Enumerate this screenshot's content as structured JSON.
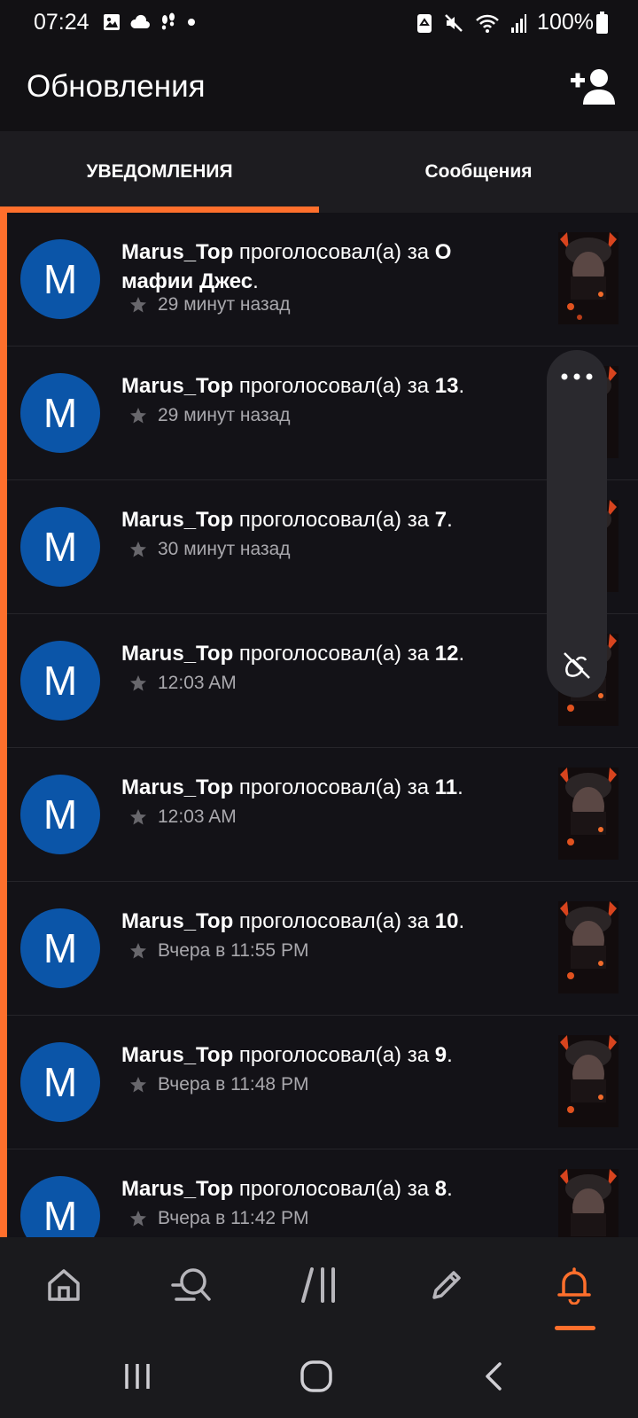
{
  "status_bar": {
    "time": "07:24",
    "battery_text": "100%",
    "left_icons": [
      "image-icon",
      "cloud-icon",
      "footsteps-icon",
      "dot-icon"
    ],
    "right_icons": [
      "recycle-icon",
      "mute-icon",
      "wifi-icon",
      "signal-icon",
      "battery-icon"
    ]
  },
  "header": {
    "title": "Обновления",
    "add_user_icon": "add-user-icon"
  },
  "tabs": [
    {
      "label": "УВЕДОМЛЕНИЯ",
      "active": true
    },
    {
      "label": "Сообщения",
      "active": false
    }
  ],
  "colors": {
    "accent": "#ff6f2c",
    "avatar_bg": "#0b55a8",
    "background": "#121114"
  },
  "notifications": [
    {
      "avatar_letter": "M",
      "user": "Marus_Top",
      "action": " проголосовал(а) за ",
      "target": "О мафии Джес",
      "end": ".",
      "time": "29 минут назад"
    },
    {
      "avatar_letter": "M",
      "user": "Marus_Top",
      "action": " проголосовал(а) за ",
      "target": "13",
      "end": ".",
      "time": "29 минут назад"
    },
    {
      "avatar_letter": "M",
      "user": "Marus_Top",
      "action": " проголосовал(а) за ",
      "target": "7",
      "end": ".",
      "time": "30 минут назад"
    },
    {
      "avatar_letter": "M",
      "user": "Marus_Top",
      "action": " проголосовал(а) за ",
      "target": "12",
      "end": ".",
      "time": "12:03 AM"
    },
    {
      "avatar_letter": "M",
      "user": "Marus_Top",
      "action": " проголосовал(а) за ",
      "target": "11",
      "end": ".",
      "time": "12:03 AM"
    },
    {
      "avatar_letter": "M",
      "user": "Marus_Top",
      "action": " проголосовал(а) за ",
      "target": "10",
      "end": ".",
      "time": "Вчера в 11:55 PM"
    },
    {
      "avatar_letter": "M",
      "user": "Marus_Top",
      "action": " проголосовал(а) за ",
      "target": "9",
      "end": ".",
      "time": "Вчера в 11:48 PM"
    },
    {
      "avatar_letter": "M",
      "user": "Marus_Top",
      "action": " проголосовал(а) за ",
      "target": "8",
      "end": ".",
      "time": "Вчера в 11:42 PM"
    }
  ],
  "side_panel": {
    "icons": [
      "more-dots-icon",
      "mute-pin-icon"
    ]
  },
  "bottom_nav": [
    {
      "icon": "home-icon",
      "active": false
    },
    {
      "icon": "search-icon",
      "active": false
    },
    {
      "icon": "library-icon",
      "active": false
    },
    {
      "icon": "pencil-icon",
      "active": false
    },
    {
      "icon": "bell-icon",
      "active": true
    }
  ],
  "system_nav": [
    "recents-icon",
    "home-circle-icon",
    "back-icon"
  ]
}
